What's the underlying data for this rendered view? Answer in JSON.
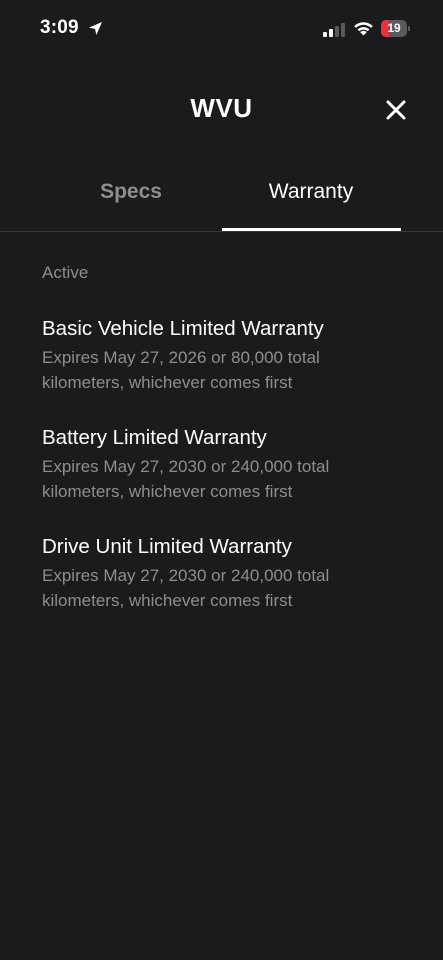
{
  "status_bar": {
    "time": "3:09",
    "battery_level": "19",
    "battery_fraction": 0.19,
    "battery_color": "#e5343f",
    "icons": [
      "location-arrow-icon",
      "cellular-signal-icon",
      "wifi-icon",
      "battery-icon"
    ]
  },
  "header": {
    "title": "WVU",
    "close_icon": "close-icon"
  },
  "tabs": [
    {
      "label": "Specs",
      "selected": false
    },
    {
      "label": "Warranty",
      "selected": true
    }
  ],
  "section": {
    "label": "Active"
  },
  "warranties": [
    {
      "title": "Basic Vehicle Limited Warranty",
      "description": "Expires May 27, 2026 or 80,000 total kilometers, whichever comes first"
    },
    {
      "title": "Battery Limited Warranty",
      "description": "Expires May 27, 2030 or 240,000 total kilometers, whichever comes first"
    },
    {
      "title": "Drive Unit Limited Warranty",
      "description": "Expires May 27, 2030 or 240,000 total kilometers, whichever comes first"
    }
  ],
  "colors": {
    "background": "#1a1b1d",
    "primary_text": "#ffffff",
    "secondary_text": "#8d8e92",
    "divider": "#38393c"
  }
}
